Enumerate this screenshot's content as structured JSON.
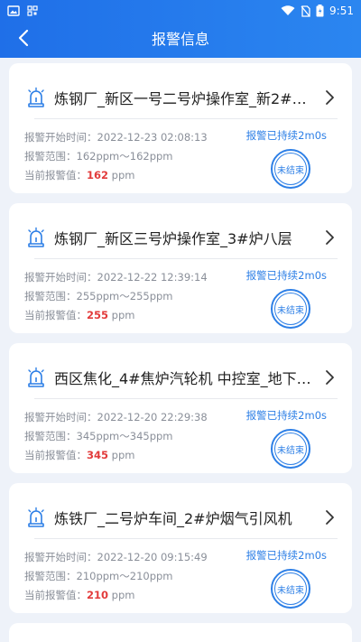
{
  "status_bar": {
    "time": "9:51"
  },
  "header": {
    "title": "报警信息"
  },
  "labels": {
    "start_time": "报警开始时间：",
    "range": "报警范围：",
    "current": "当前报警值：",
    "unit": "ppm"
  },
  "cards": [
    {
      "title": "炼钢厂_新区一号二号炉操作室_新2#…",
      "start_time": "2022-12-23 02:08:13",
      "range": "162ppm～162ppm",
      "current": "162",
      "duration": "报警已持续2m0s",
      "stamp": "未结束"
    },
    {
      "title": "炼钢厂_新区三号炉操作室_3#炉八层",
      "start_time": "2022-12-22 12:39:14",
      "range": "255ppm～255ppm",
      "current": "255",
      "duration": "报警已持续2m0s",
      "stamp": "未结束"
    },
    {
      "title": "西区焦化_4#焦炉汽轮机 中控室_地下…",
      "start_time": "2022-12-20 22:29:38",
      "range": "345ppm～345ppm",
      "current": "345",
      "duration": "报警已持续2m0s",
      "stamp": "未结束"
    },
    {
      "title": "炼铁厂_二号炉车间_2#炉烟气引风机",
      "start_time": "2022-12-20 09:15:49",
      "range": "210ppm～210ppm",
      "current": "210",
      "duration": "报警已持续2m0s",
      "stamp": "未结束"
    }
  ]
}
